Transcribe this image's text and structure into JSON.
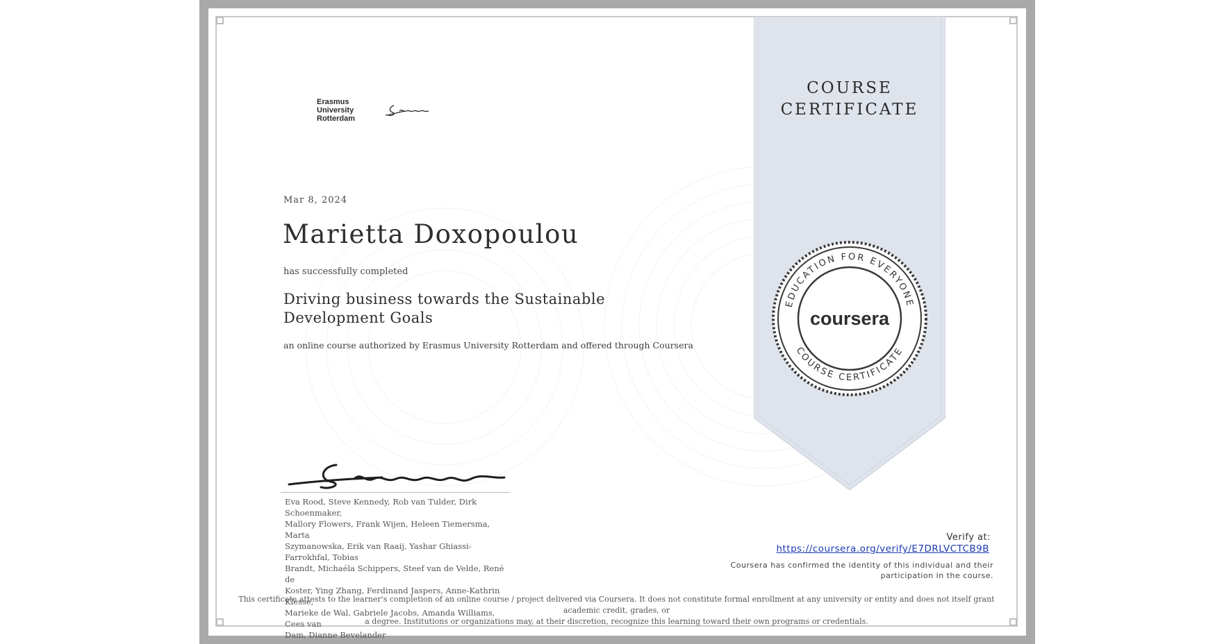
{
  "logo": {
    "line1": "Erasmus",
    "line2": "University",
    "line3": "Rotterdam"
  },
  "ribbon": {
    "title_line1": "COURSE",
    "title_line2": "CERTIFICATE"
  },
  "seal": {
    "top_arc": "EDUCATION FOR EVERYONE",
    "bottom_arc": "COURSE CERTIFICATE",
    "brand": "coursera"
  },
  "certificate": {
    "date": "Mar 8, 2024",
    "recipient": "Marietta Doxopoulou",
    "completed_text": "has successfully completed",
    "course_line1": "Driving business towards the Sustainable",
    "course_line2": "Development Goals",
    "authorized_text": "an online course authorized by Erasmus University Rotterdam and offered through Coursera"
  },
  "instructors": {
    "lines": [
      "Eva Rood, Steve Kennedy, Rob van Tulder, Dirk Schoenmaker,",
      "Mallory Flowers, Frank Wijen, Heleen Tiemersma, Marta",
      "Szymanowska, Erik van Raaij, Yashar Ghiassi-Farrokhfal, Tobias",
      "Brandt, Michaéla Schippers, Steef van de Velde, René de",
      "Koster, Ying Zhang, Ferdinand Jaspers, Anne-Kathrin Klesse,",
      "Marieke de Wal, Gabriele Jacobs, Amanda Williams, Cees van",
      "Dam, Dianne Bevelander"
    ]
  },
  "verify": {
    "label": "Verify at:",
    "link": "https://coursera.org/verify/E7DRLVCTCB9B",
    "note_line1": "Coursera has confirmed the identity of this individual and their",
    "note_line2": "participation in the course."
  },
  "disclaimer": {
    "line1": "This certificate attests to the learner's completion of an online course / project delivered via Coursera. It does not constitute formal enrollment at any university or entity and does not itself grant academic credit, grades, or",
    "line2": "a degree. Institutions or organizations may, at their discretion, recognize this learning toward their own programs or credentials."
  },
  "colors": {
    "ribbon": "#dfe4ec",
    "frame": "#a9a9a9",
    "link": "#1a3bb0"
  }
}
